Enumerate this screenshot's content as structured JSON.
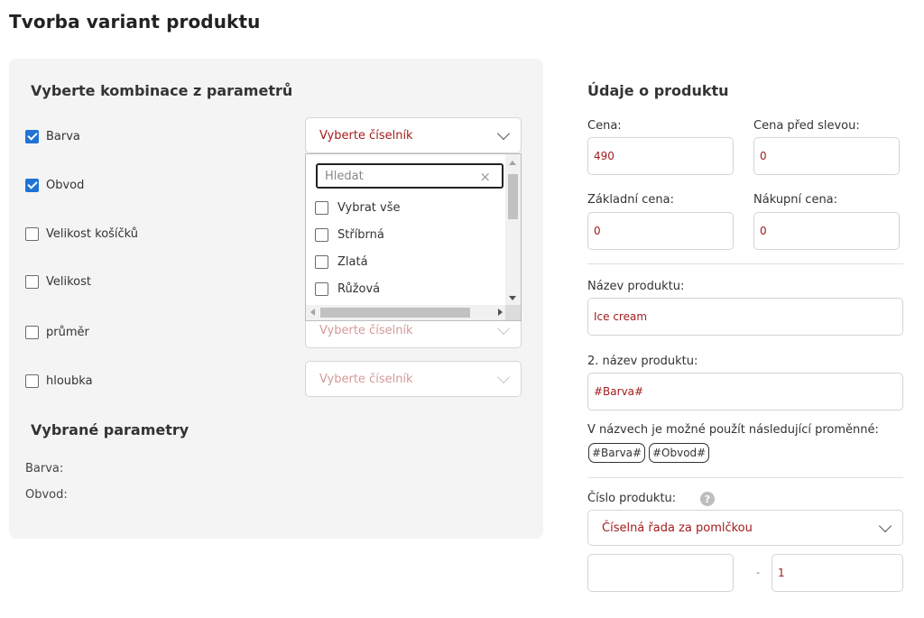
{
  "page": {
    "title": "Tvorba variant produktu"
  },
  "left": {
    "section_title": "Vyberte kombinace z parametrů",
    "params": [
      {
        "label": "Barva",
        "checked": true,
        "select": "Vyberte číselník"
      },
      {
        "label": "Obvod",
        "checked": true,
        "select": ""
      },
      {
        "label": "Velikost košíčků",
        "checked": false,
        "select": ""
      },
      {
        "label": "Velikost",
        "checked": false,
        "select": ""
      },
      {
        "label": "průměr",
        "checked": false,
        "select": "Vyberte číselník"
      },
      {
        "label": "hloubka",
        "checked": false,
        "select": "Vyberte číselník"
      }
    ],
    "dropdown": {
      "search_placeholder": "Hledat",
      "items": [
        {
          "label": "Vybrat vše",
          "checked": false
        },
        {
          "label": "Stříbrná",
          "checked": false
        },
        {
          "label": "Zlatá",
          "checked": false
        },
        {
          "label": "Růžová",
          "checked": false
        }
      ]
    },
    "selected_title": "Vybrané parametry",
    "selected_params": [
      "Barva:",
      "Obvod:"
    ]
  },
  "right": {
    "title": "Údaje o produktu",
    "cena_label": "Cena:",
    "cena_value": "490",
    "cena_pred_slevou_label": "Cena před slevou:",
    "cena_pred_slevou_value": "0",
    "zakladni_cena_label": "Základní cena:",
    "zakladni_cena_value": "0",
    "nakupni_cena_label": "Nákupní cena:",
    "nakupni_cena_value": "0",
    "nazev_label": "Název produktu:",
    "nazev_value": "Ice cream",
    "nazev2_label": "2. název produktu:",
    "nazev2_value": "#Barva#",
    "variables_text": "V názvech je možné použít následující proměnné:",
    "variables": [
      "#Barva#",
      "#Obvod#"
    ],
    "cislo_label": "Číslo produktu:",
    "cislo_help": "?",
    "cislo_select": "Číselná řada za pomlčkou",
    "cislo_prefix": "",
    "cislo_separator": "-",
    "cislo_suffix": "1"
  },
  "colors": {
    "accent": "#1f73d6",
    "value_text": "#a31c1c",
    "panel_bg": "#f4f4f4"
  }
}
